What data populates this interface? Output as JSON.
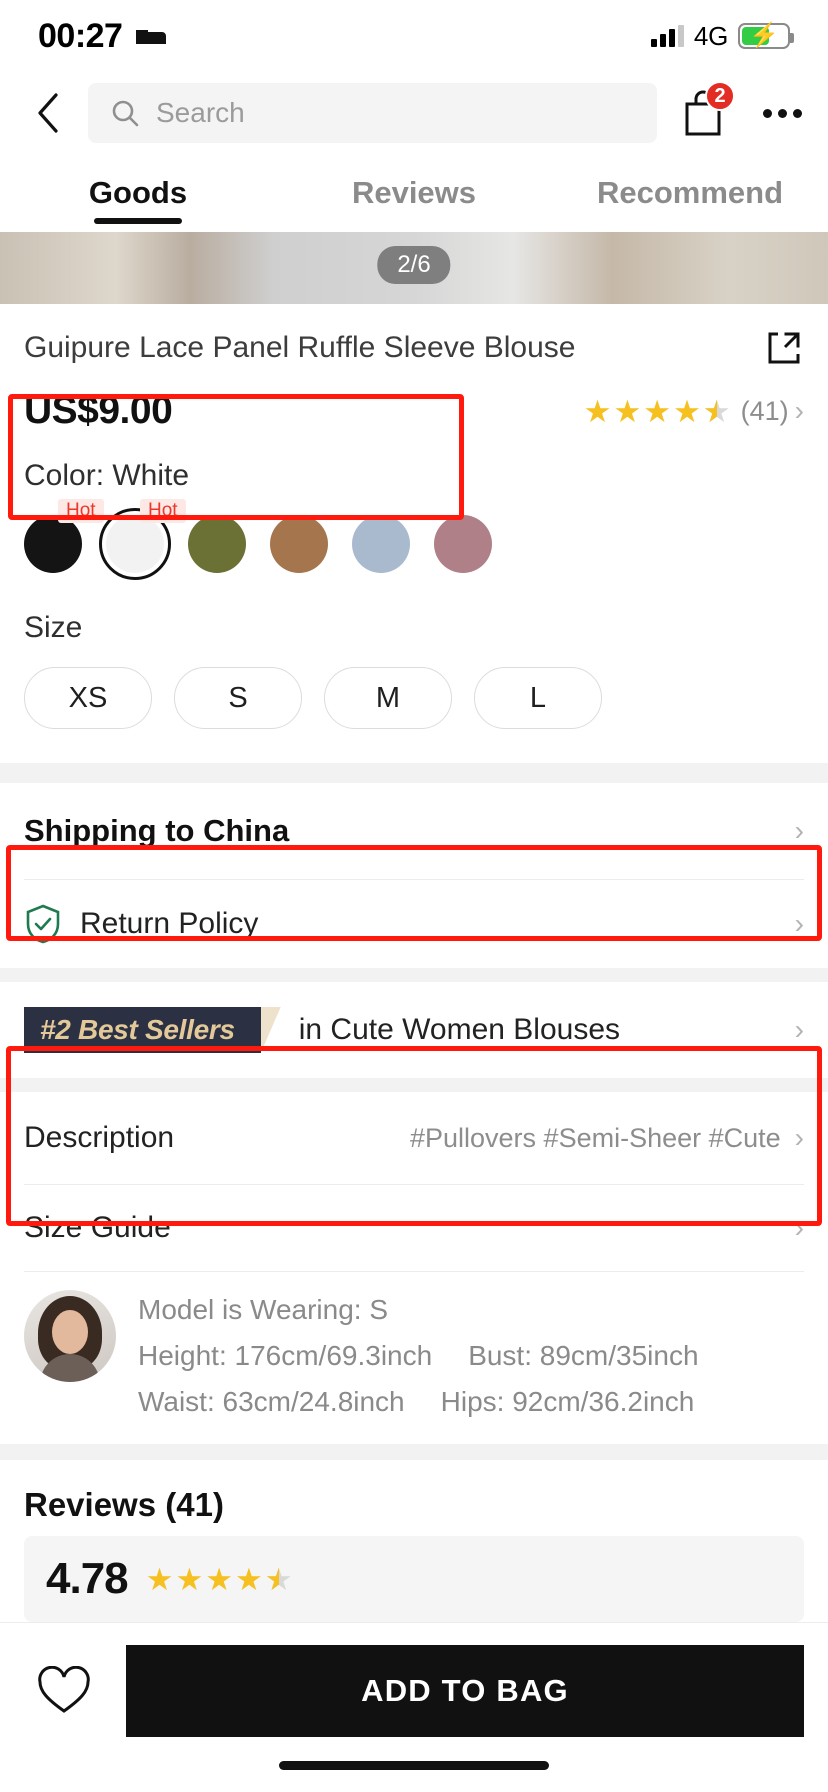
{
  "status_bar": {
    "time": "00:27",
    "bed_icon": "bed-icon",
    "signal_icon": "signal-bars-icon",
    "network": "4G",
    "battery_icon": "battery-charging-icon",
    "battery_level_pct": 62
  },
  "top_nav": {
    "back_icon": "chevron-left-icon",
    "search_placeholder": "Search",
    "search_value": "",
    "search_icon": "search-icon",
    "bag_icon": "shopping-bag-icon",
    "bag_count": "2",
    "more_icon": "more-dots-icon"
  },
  "tabs": [
    {
      "label": "Goods",
      "active": true
    },
    {
      "label": "Reviews",
      "active": false
    },
    {
      "label": "Recommend",
      "active": false
    }
  ],
  "gallery": {
    "counter": "2/6"
  },
  "product": {
    "title": "Guipure Lace Panel Ruffle Sleeve Blouse",
    "share_icon": "share-external-icon",
    "price": "US$9.00",
    "rating_value": 4.5,
    "review_count_label": "(41)"
  },
  "color": {
    "label": "Color: White",
    "selected": "White",
    "hot_label": "Hot",
    "swatches": [
      {
        "name": "Black",
        "hex": "#141414",
        "hot": true,
        "selected": false
      },
      {
        "name": "White",
        "hex": "#f2f2f2",
        "hot": true,
        "selected": true
      },
      {
        "name": "Olive",
        "hex": "#6b7034",
        "hot": false,
        "selected": false
      },
      {
        "name": "Tan",
        "hex": "#a5764e",
        "hot": false,
        "selected": false
      },
      {
        "name": "Blue Grey",
        "hex": "#a9bacf",
        "hot": false,
        "selected": false
      },
      {
        "name": "Mauve",
        "hex": "#b08089",
        "hot": false,
        "selected": false
      }
    ]
  },
  "size": {
    "label": "Size",
    "options": [
      "XS",
      "S",
      "M",
      "L"
    ],
    "selected": ""
  },
  "shipping": {
    "label": "Shipping to China"
  },
  "return_policy": {
    "label": "Return Policy",
    "icon": "shield-check-icon"
  },
  "best_sellers": {
    "rank_label": "#2 Best Sellers",
    "category_text": "in Cute Women Blouses",
    "badge_bg": "#2b3043",
    "badge_text_color": "#e3c999"
  },
  "description": {
    "label": "Description",
    "tags": "#Pullovers  #Semi-Sheer  #Cute"
  },
  "size_guide": {
    "label": "Size Guide",
    "model_wearing": "Model is Wearing: S",
    "height": "Height: 176cm/69.3inch",
    "bust": "Bust: 89cm/35inch",
    "waist": "Waist: 63cm/24.8inch",
    "hips": "Hips: 92cm/36.2inch"
  },
  "reviews": {
    "heading": "Reviews (41)",
    "score": "4.78",
    "score_stars": 4.5
  },
  "bottom_bar": {
    "favorite_icon": "heart-icon",
    "add_to_bag_label": "ADD TO BAG"
  },
  "colors": {
    "accent_red": "#ff1a0d",
    "dark": "#111111"
  }
}
